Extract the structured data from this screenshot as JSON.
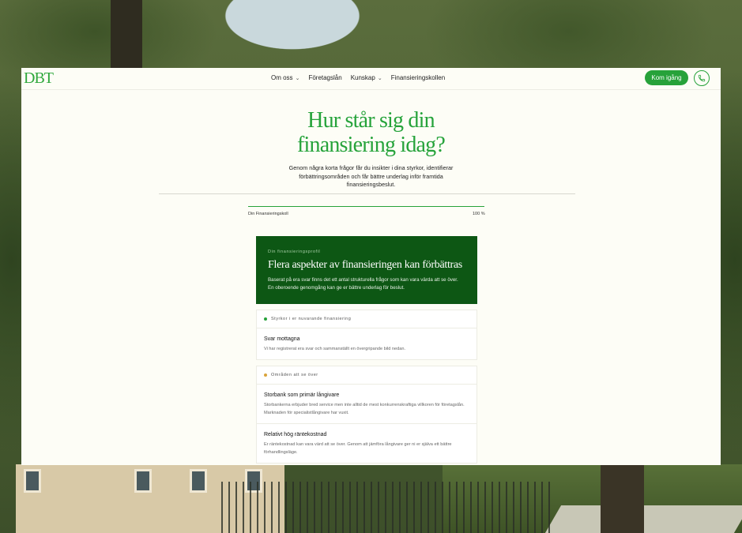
{
  "brand": {
    "logo": "DBT",
    "accent": "#27a23a",
    "dark_green": "#0d5714"
  },
  "nav": {
    "items": [
      {
        "label": "Om oss",
        "has_dropdown": true
      },
      {
        "label": "Företagslån",
        "has_dropdown": false
      },
      {
        "label": "Kunskap",
        "has_dropdown": true
      },
      {
        "label": "Finansieringskollen",
        "has_dropdown": false
      }
    ],
    "cta_label": "Kom igång",
    "phone_icon": "phone-icon"
  },
  "hero": {
    "title_line1": "Hur står sig din",
    "title_line2": "finansiering idag?",
    "subtitle": "Genom några korta frågor får du insikter i dina styrkor, identifierar förbättringsområden och får bättre underlag inför framtida finansieringsbeslut."
  },
  "progress": {
    "label": "Din Finansieringskoll",
    "value_text": "100 %",
    "fraction": 1.0
  },
  "profile": {
    "kicker": "Din finansieringsprofil",
    "title": "Flera aspekter av finansieringen kan förbättras",
    "description": "Baserat på era svar finns det ett antal strukturella frågor som kan vara värda att se över. En oberoende genomgång kan ge er bättre underlag för beslut."
  },
  "strengths": {
    "heading": "Styrkor i er nuvarande finansiering",
    "dot_color": "#27a23a",
    "items": [
      {
        "title": "Svar mottagna",
        "text": "Vi har registrerat era svar och sammanställt en övergripande bild nedan."
      }
    ]
  },
  "areas": {
    "heading": "Områden att se över",
    "dot_color": "#d9a33a",
    "items": [
      {
        "title": "Storbank som primär långivare",
        "text": "Storbankerna erbjuder bred service men inte alltid de mest konkurrenskraftiga villkoren för företagslån. Marknaden för specialistlångivare har vuxit."
      },
      {
        "title": "Relativt hög räntekostnad",
        "text": "Er räntekostnad kan vara värd att se över. Genom att jämföra långivare ger ni er själva ett bättre förhandlingsläge."
      }
    ]
  }
}
